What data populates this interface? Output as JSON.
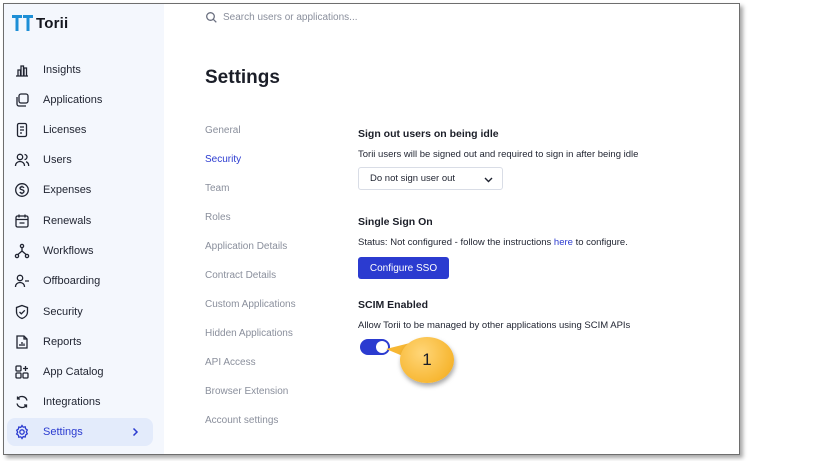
{
  "app": {
    "name": "Torii"
  },
  "search": {
    "placeholder": "Search users or applications..."
  },
  "sidebar": {
    "items": [
      {
        "label": "Insights",
        "icon": "chart-bar-icon"
      },
      {
        "label": "Applications",
        "icon": "applications-icon"
      },
      {
        "label": "Licenses",
        "icon": "license-icon"
      },
      {
        "label": "Users",
        "icon": "users-icon"
      },
      {
        "label": "Expenses",
        "icon": "dollar-icon"
      },
      {
        "label": "Renewals",
        "icon": "calendar-icon"
      },
      {
        "label": "Workflows",
        "icon": "workflow-icon"
      },
      {
        "label": "Offboarding",
        "icon": "user-minus-icon"
      },
      {
        "label": "Security",
        "icon": "shield-icon"
      },
      {
        "label": "Reports",
        "icon": "report-icon"
      },
      {
        "label": "App Catalog",
        "icon": "catalog-icon"
      },
      {
        "label": "Integrations",
        "icon": "integrations-icon"
      },
      {
        "label": "Settings",
        "icon": "gear-icon",
        "active": true
      }
    ]
  },
  "page": {
    "title": "Settings"
  },
  "subnav": {
    "items": [
      "General",
      "Security",
      "Team",
      "Roles",
      "Application Details",
      "Contract Details",
      "Custom Applications",
      "Hidden Applications",
      "API Access",
      "Browser Extension",
      "Account settings"
    ],
    "active": "Security"
  },
  "sections": {
    "idle": {
      "title": "Sign out users on being idle",
      "description": "Torii users will be signed out and required to sign in after being idle",
      "select_value": "Do not sign user out"
    },
    "sso": {
      "title": "Single Sign On",
      "status_prefix": "Status: Not configured - follow the instructions",
      "link_text": "here",
      "status_suffix": "to configure.",
      "button_label": "Configure SSO"
    },
    "scim": {
      "title": "SCIM Enabled",
      "description": "Allow Torii to be managed by other applications using SCIM APIs",
      "enabled": true
    }
  },
  "callout": {
    "number": "1"
  },
  "colors": {
    "accent": "#2b3bd0",
    "sidebar_bg": "#f4f7fd",
    "callout": "#f7b733",
    "logo": "#1e8fd6"
  }
}
